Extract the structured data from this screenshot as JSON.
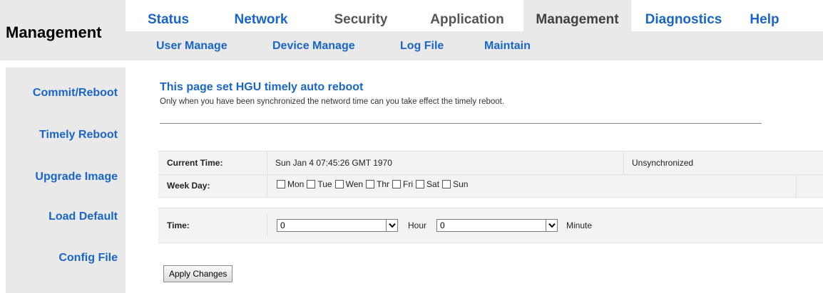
{
  "header": {
    "title": "Management"
  },
  "top_nav": {
    "tabs": [
      {
        "label": "Status"
      },
      {
        "label": "Network"
      },
      {
        "label": "Security"
      },
      {
        "label": "Application"
      },
      {
        "label": "Management"
      },
      {
        "label": "Diagnostics"
      },
      {
        "label": "Help"
      }
    ],
    "active": "Management"
  },
  "sub_nav": {
    "items": [
      {
        "label": "User Manage"
      },
      {
        "label": "Device Manage"
      },
      {
        "label": "Log File"
      },
      {
        "label": "Maintain"
      }
    ]
  },
  "sidebar": {
    "items": [
      {
        "label": "Commit/Reboot"
      },
      {
        "label": "Timely Reboot"
      },
      {
        "label": "Upgrade Image"
      },
      {
        "label": "Load Default"
      },
      {
        "label": "Config File"
      }
    ]
  },
  "page": {
    "title": "This page set HGU timely auto reboot",
    "description": "Only when you have been synchronized the netword time can you take effect the timely reboot."
  },
  "form": {
    "current_time_label": "Current Time:",
    "current_time_value": "Sun Jan 4 07:45:26 GMT 1970",
    "sync_status": "Unsynchronized",
    "week_day_label": "Week Day:",
    "days": [
      "Mon",
      "Tue",
      "Wen",
      "Thr",
      "Fri",
      "Sat",
      "Sun"
    ],
    "time_label": "Time:",
    "hour_value": "0",
    "hour_label": "Hour",
    "minute_value": "0",
    "minute_label": "Minute",
    "apply_label": "Apply Changes"
  },
  "colors": {
    "link_blue": "#1a66c7",
    "panel_gray": "#e9e9e9"
  }
}
